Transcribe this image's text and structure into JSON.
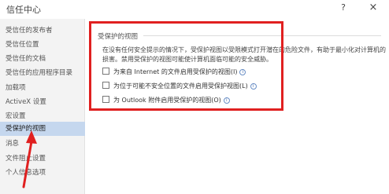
{
  "window": {
    "title": "信任中心",
    "help_label": "?",
    "close_label": "×"
  },
  "sidebar": {
    "items": [
      {
        "label": "受信任的发布者",
        "active": false
      },
      {
        "label": "受信任位置",
        "active": false
      },
      {
        "label": "受信任的文档",
        "active": false
      },
      {
        "label": "受信任的应用程序目录",
        "active": false
      },
      {
        "label": "加载项",
        "active": false
      },
      {
        "label": "ActiveX 设置",
        "active": false
      },
      {
        "label": "宏设置",
        "active": false
      },
      {
        "label": "受保护的视图",
        "active": true
      },
      {
        "label": "消息",
        "active": false
      },
      {
        "label": "文件阻止设置",
        "active": false
      },
      {
        "label": "个人信息选项",
        "active": false
      }
    ]
  },
  "main": {
    "section_title": "受保护的视图",
    "description": "在没有任何安全提示的情况下，受保护视图以受限模式打开潜在的危险文件，有助于最小化对计算机的损害。禁用受保护的视图可能使计算机面临可能的安全威胁。",
    "options": [
      {
        "label": "为来自 Internet 的文件启用受保护的视图(I)",
        "info_icon": "info-icon"
      },
      {
        "label": "为位于可能不安全位置的文件启用受保护视图(L)",
        "info_icon": "info-icon"
      },
      {
        "label": "为 Outlook 附件启用受保护的视图(O)",
        "info_icon": "info-icon"
      }
    ]
  },
  "colors": {
    "annotation": "#e02020",
    "active_item": "#c5d7ee",
    "sidebar_bg": "#f3f3f3"
  }
}
